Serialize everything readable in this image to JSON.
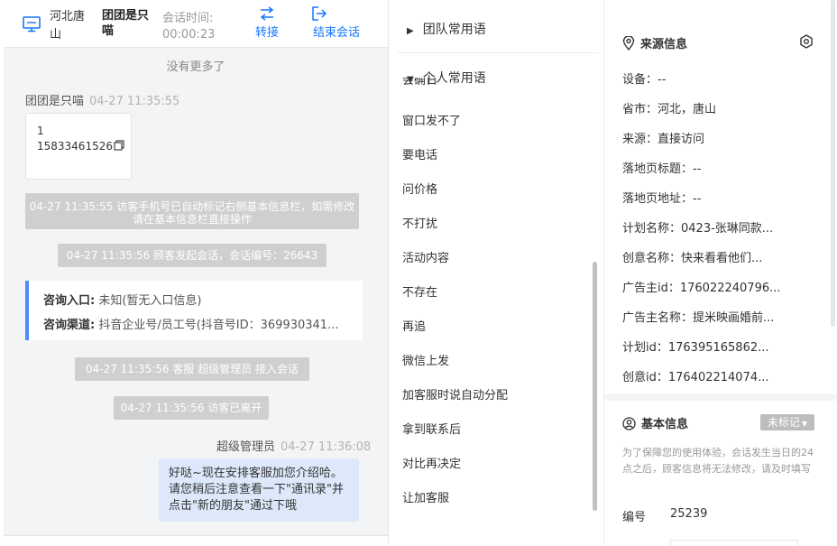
{
  "header": {
    "visitor_location": "河北唐山",
    "visitor_name": "团团是只喵",
    "session_time_label": "会话时间:",
    "session_time_value": "00:00:23",
    "transfer_label": "转接",
    "end_session_label": "结束会话"
  },
  "chat": {
    "no_more": "没有更多了",
    "visitor_msg": {
      "sender": "团团是只喵",
      "time": "04-27 11:35:55",
      "line1": "1",
      "line2": "15833461526"
    },
    "system_notices": [
      "04-27 11:35:55 访客手机号已自动标记右侧基本信息栏，如需修改请在基本信息栏直接操作",
      "04-27 11:35:56 顾客发起会话，会话编号：26643"
    ],
    "consult_entry_label": "咨询入口:",
    "consult_entry_value": "未知(暂无入口信息)",
    "consult_channel_label": "咨询渠道:",
    "consult_channel_value": "抖音企业号/员工号(抖音号ID：369930341...",
    "system_notices_2": [
      "04-27 11:35:56 客服 超级管理员 接入会话",
      "04-27 11:35:56 访客已离开"
    ],
    "agent_msg": {
      "sender": "超级管理员",
      "time": "04-27 11:36:08",
      "text": "好哒~现在安排客服加您介绍哈。请您稍后注意查看一下\"通讯录\"并点击\"新的朋友\"通过下哦"
    }
  },
  "phrases": {
    "team_group": "团队常用语",
    "personal_group": "个人常用语",
    "clipped_item": "会确日",
    "items": [
      "窗口发不了",
      "要电话",
      "问价格",
      "不打扰",
      "活动内容",
      "不存在",
      "再追",
      "微信上发",
      "加客服时说自动分配",
      "拿到联系后",
      "对比再决定",
      "让加客服"
    ]
  },
  "info": {
    "source_title": "来源信息",
    "rows": [
      "设备：--",
      "省市：河北，唐山",
      "来源：直接访问",
      "落地页标题：--",
      "落地页地址：--",
      "计划名称：0423-张琳同款...",
      "创意名称：快来看看他们...",
      "广告主id：176022240796...",
      "广告主名称：提米映画婚前...",
      "计划id：176395165862...",
      "创意id：176402214074..."
    ],
    "basic_title": "基本信息",
    "mark_label": "未标记",
    "notice": "为了保障您的使用体验，会话发生当日的24点之后，顾客信息将无法修改，请及时填写",
    "id_label": "编号",
    "id_value": "25239"
  },
  "colors": {
    "accent": "#1677ff",
    "bubble": "#dde9fb",
    "pill": "#cfcfcf",
    "bar": "#4e8bff"
  }
}
